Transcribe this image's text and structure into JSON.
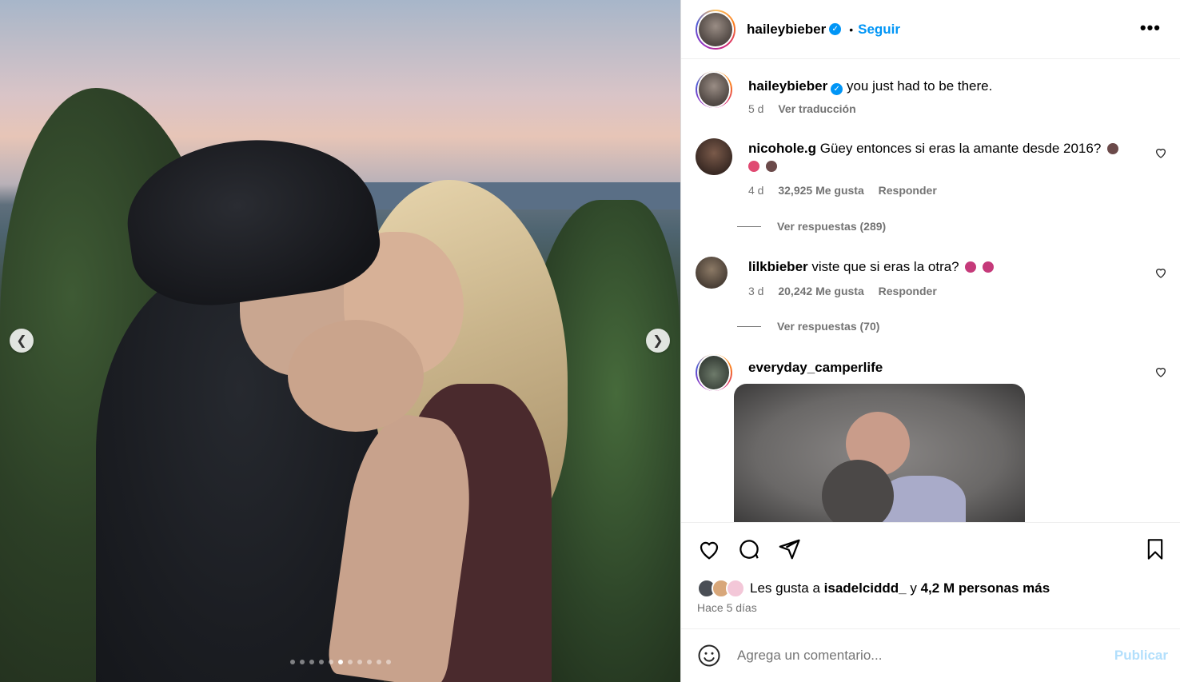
{
  "post": {
    "author": "haileybieber",
    "follow_label": "Seguir",
    "separator": "•",
    "more_label": "•••",
    "caption": "you just had to be there.",
    "caption_age": "5 d",
    "translate_label": "Ver traducción"
  },
  "carousel": {
    "dot_count": 11,
    "active_index": 5
  },
  "comments": [
    {
      "user": "nicohole.g",
      "text_line1": "Güey entonces si eras la amante desde 2016?",
      "age": "4 d",
      "likes": "32,925 Me gusta",
      "reply_label": "Responder",
      "replies_label": "Ver respuestas (289)"
    },
    {
      "user": "lilkbieber",
      "text_line1": "viste que si eras la otra?",
      "age": "3 d",
      "likes": "20,242 Me gusta",
      "reply_label": "Responder",
      "replies_label": "Ver respuestas (70)"
    },
    {
      "user": "everyday_camperlife"
    }
  ],
  "likes": {
    "prefix": "Les gusta a",
    "first_user": "isadelciddd_",
    "joiner": "y",
    "others": "4,2 M personas más",
    "age": "Hace 5 días"
  },
  "add_comment": {
    "placeholder": "Agrega un comentario...",
    "publish_label": "Publicar"
  },
  "colors": {
    "accent": "#0095f6",
    "publish_disabled": "#b2dffc",
    "muted": "#737373"
  }
}
